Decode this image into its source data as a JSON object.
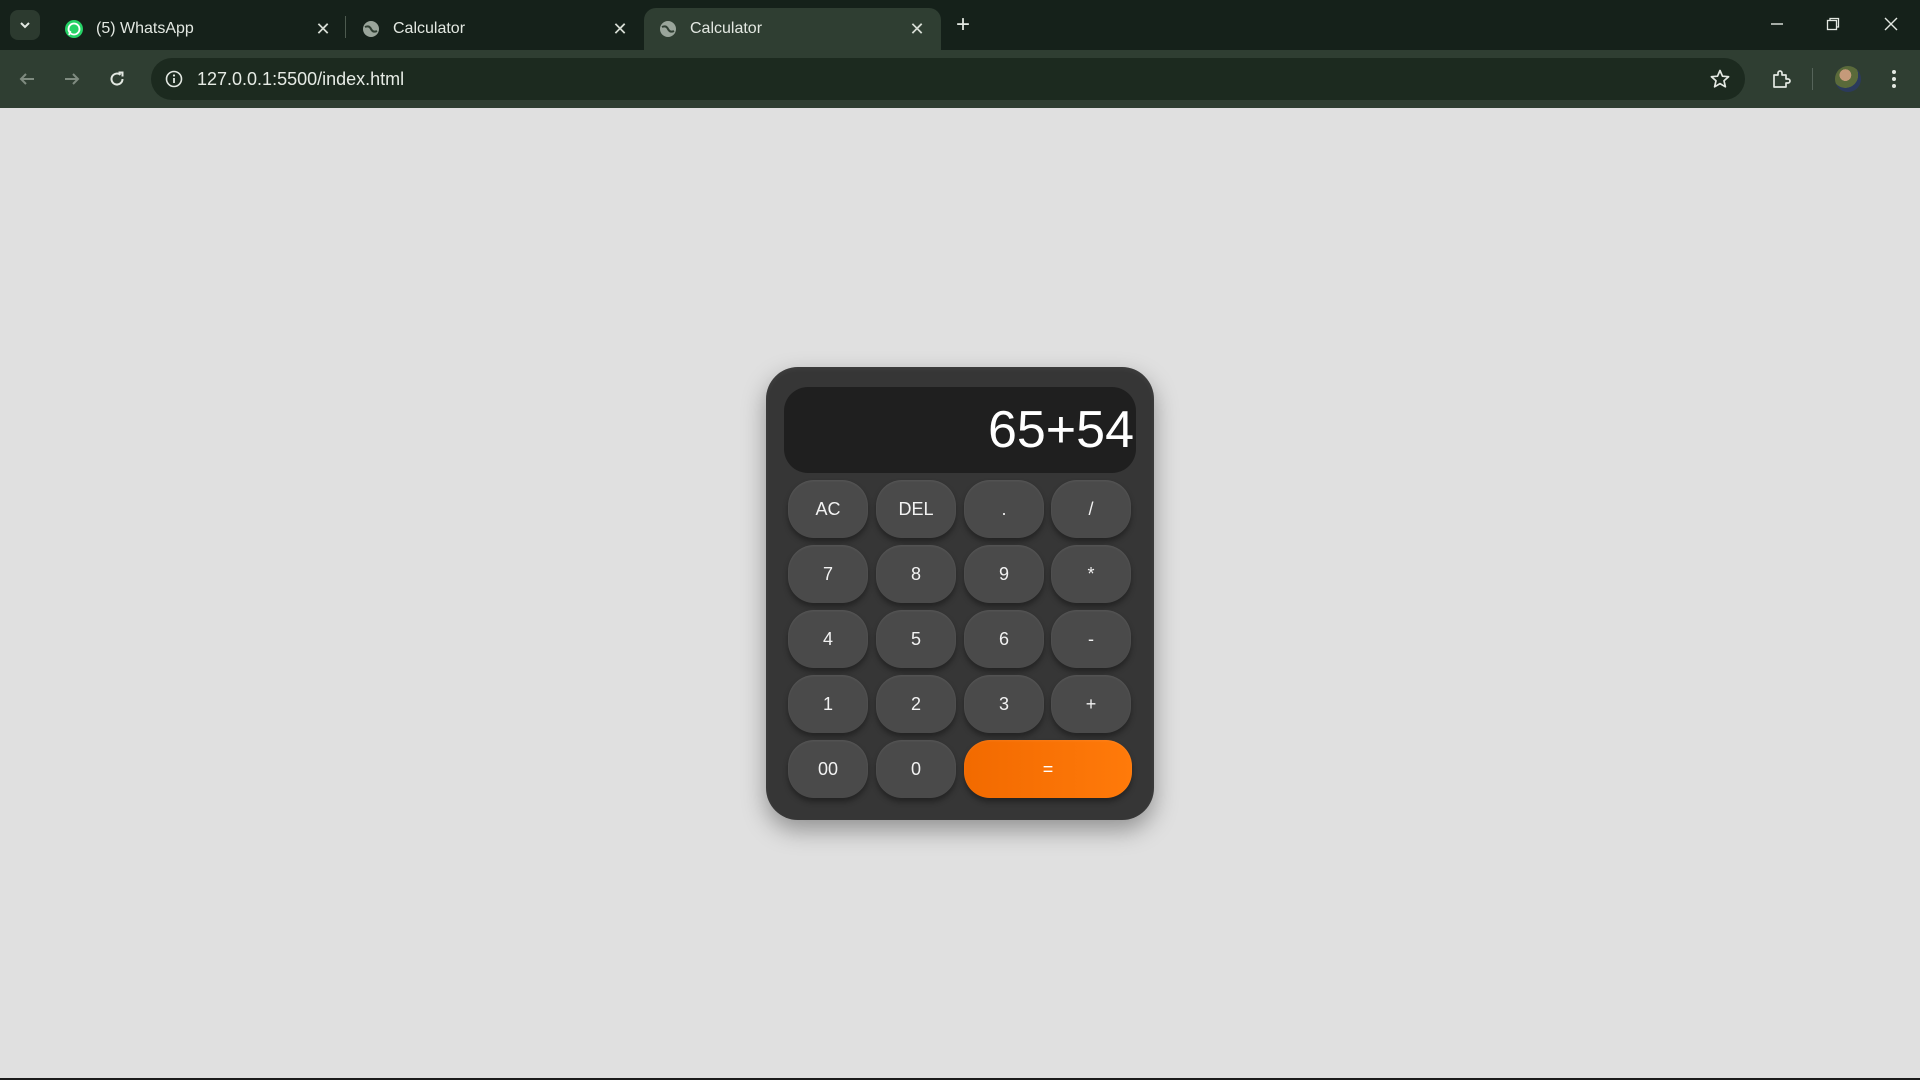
{
  "browser": {
    "tabs": [
      {
        "title": "(5) WhatsApp",
        "icon": "whatsapp-icon",
        "active": false
      },
      {
        "title": "Calculator",
        "icon": "globe-icon",
        "active": false
      },
      {
        "title": "Calculator",
        "icon": "globe-icon",
        "active": true
      }
    ],
    "new_tab_label": "+",
    "url": "127.0.0.1:5500/index.html"
  },
  "calculator": {
    "display": "65+54",
    "keys": [
      [
        "AC",
        "DEL",
        ".",
        "/"
      ],
      [
        "7",
        "8",
        "9",
        "*"
      ],
      [
        "4",
        "5",
        "6",
        "-"
      ],
      [
        "1",
        "2",
        "3",
        "+"
      ],
      [
        "00",
        "0",
        "="
      ]
    ],
    "accent_color": "#ff7a0a",
    "body_color": "#363636",
    "key_color": "#4a4a4a",
    "page_background": "#e0e0e0"
  }
}
